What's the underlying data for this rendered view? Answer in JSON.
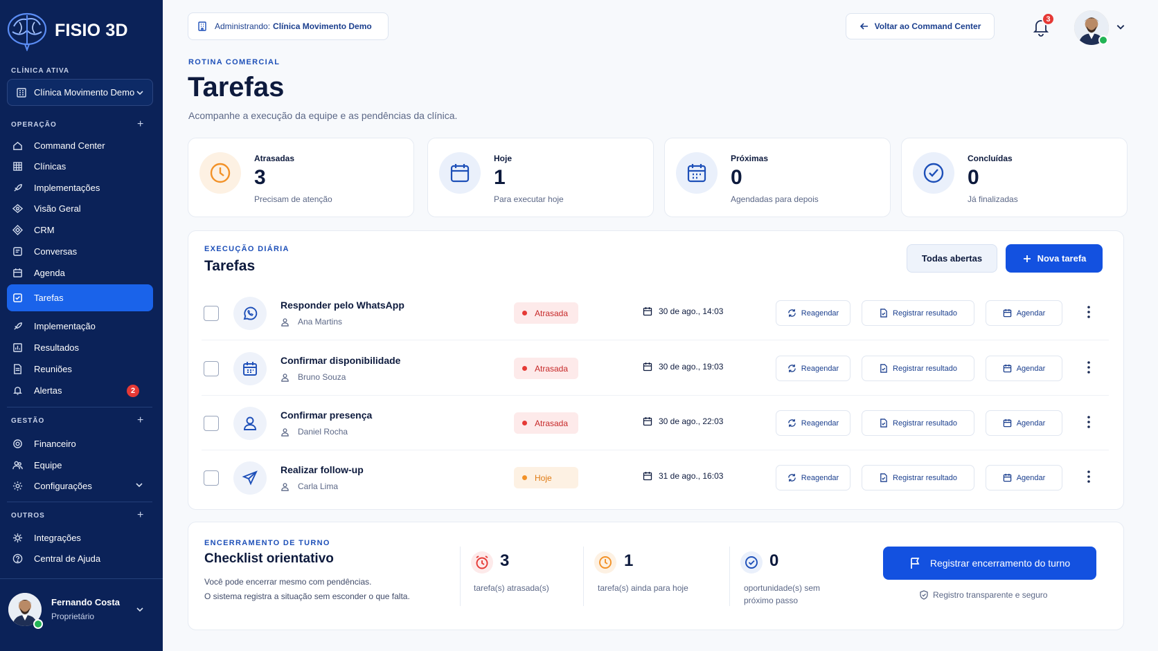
{
  "brand": {
    "name": "FISIO 3D"
  },
  "sidebar": {
    "active_clinic_label": "CLÍNICA ATIVA",
    "active_clinic": "Clínica Movimento Demo",
    "sections": {
      "operacao": "OPERAÇÃO",
      "gestao": "GESTÃO",
      "outros": "OUTROS"
    },
    "items": [
      {
        "label": "Command Center",
        "icon": "home-icon"
      },
      {
        "label": "Clínicas",
        "icon": "building-icon"
      },
      {
        "label": "Implementações",
        "icon": "rocket-icon"
      },
      {
        "label": "Visão Geral",
        "icon": "eye-icon"
      },
      {
        "label": "CRM",
        "icon": "diamond-icon"
      },
      {
        "label": "Conversas",
        "icon": "chat-icon"
      },
      {
        "label": "Agenda",
        "icon": "calendar-icon"
      },
      {
        "label": "Tarefas",
        "icon": "check-square-icon",
        "active": true
      },
      {
        "label": "Implementação",
        "icon": "rocket-icon"
      },
      {
        "label": "Resultados",
        "icon": "chart-icon"
      },
      {
        "label": "Reuniões",
        "icon": "document-icon"
      },
      {
        "label": "Alertas",
        "icon": "bell-icon",
        "badge": "2"
      },
      {
        "label": "Financeiro",
        "icon": "coin-icon"
      },
      {
        "label": "Equipe",
        "icon": "team-icon"
      },
      {
        "label": "Configurações",
        "icon": "gear-icon"
      },
      {
        "label": "Integrações",
        "icon": "puzzle-icon"
      },
      {
        "label": "Central de Ajuda",
        "icon": "help-icon"
      }
    ],
    "user": {
      "name": "Fernando Costa",
      "role": "Proprietário"
    }
  },
  "header": {
    "admin_prefix": "Administrando:",
    "admin_clinic": "Clínica Movimento Demo",
    "back_label": "Voltar ao Command Center",
    "notifications": "3"
  },
  "page": {
    "eyebrow": "ROTINA COMERCIAL",
    "title": "Tarefas",
    "subtitle": "Acompanhe a execução da equipe e as pendências da clínica."
  },
  "stats": [
    {
      "label": "Atrasadas",
      "value": "3",
      "desc": "Precisam de atenção",
      "color": "#f29127"
    },
    {
      "label": "Hoje",
      "value": "1",
      "desc": "Para executar hoje",
      "color": "#1d4fb8"
    },
    {
      "label": "Próximas",
      "value": "0",
      "desc": "Agendadas para depois",
      "color": "#1d4fb8"
    },
    {
      "label": "Concluídas",
      "value": "0",
      "desc": "Já finalizadas",
      "color": "#1d4fb8"
    }
  ],
  "tasks_panel": {
    "eyebrow": "EXECUÇÃO DIÁRIA",
    "title": "Tarefas",
    "filter_label": "Todas abertas",
    "new_label": "Nova tarefa",
    "action_reschedule": "Reagendar",
    "action_register": "Registrar resultado",
    "action_schedule": "Agendar",
    "rows": [
      {
        "title": "Responder pelo WhatsApp",
        "person": "Ana Martins",
        "status": "Atrasada",
        "status_type": "late",
        "due": "30 de ago., 14:03",
        "icon": "whatsapp-icon"
      },
      {
        "title": "Confirmar disponibilidade",
        "person": "Bruno Souza",
        "status": "Atrasada",
        "status_type": "late",
        "due": "30 de ago., 19:03",
        "icon": "calendar-icon"
      },
      {
        "title": "Confirmar presença",
        "person": "Daniel Rocha",
        "status": "Atrasada",
        "status_type": "late",
        "due": "30 de ago., 22:03",
        "icon": "user-icon"
      },
      {
        "title": "Realizar follow-up",
        "person": "Carla Lima",
        "status": "Hoje",
        "status_type": "today",
        "due": "31 de ago., 16:03",
        "icon": "send-icon"
      }
    ]
  },
  "checklist": {
    "eyebrow": "ENCERRAMENTO DE TURNO",
    "title": "Checklist orientativo",
    "desc_line1": "Você pode encerrar mesmo com pendências.",
    "desc_line2": "O sistema registra a situação sem esconder o que falta.",
    "metrics": [
      {
        "value": "3",
        "label_line1": "tarefa(s) atrasada(s)",
        "label_line2": ""
      },
      {
        "value": "1",
        "label_line1": "tarefa(s) ainda para hoje",
        "label_line2": ""
      },
      {
        "value": "0",
        "label_line1": "oportunidade(s) sem",
        "label_line2": "próximo passo"
      }
    ],
    "close_label": "Registrar encerramento do turno",
    "secure_note": "Registro transparente e seguro"
  },
  "colors": {
    "sidebar": "#0b2258",
    "primary": "#1351e0",
    "late": "#e53935",
    "today": "#f29127"
  }
}
